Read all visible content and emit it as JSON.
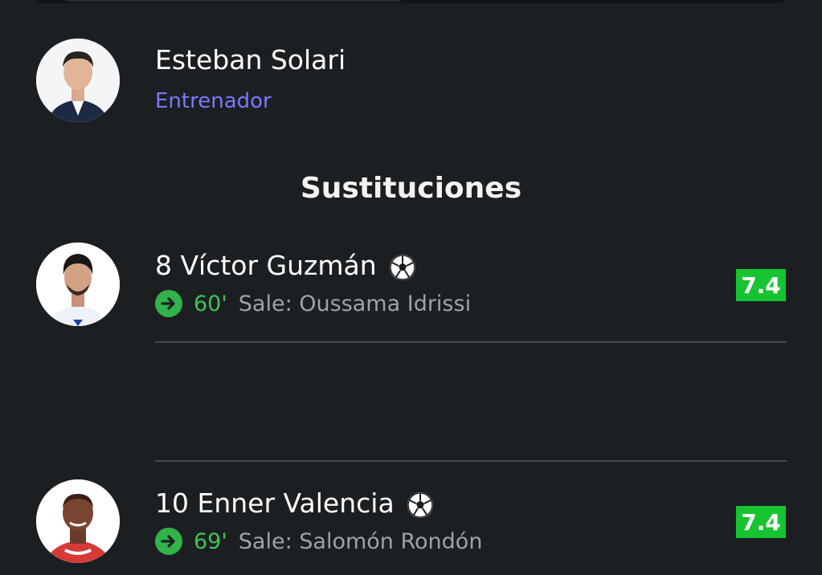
{
  "coach": {
    "name": "Esteban Solari",
    "role": "Entrenador"
  },
  "section_title": "Sustituciones",
  "substitutions": [
    {
      "player": "8 Víctor Guzmán",
      "minute": "60'",
      "out_text": "Sale: Oussama Idrissi",
      "rating": "7.4",
      "icons": [
        "soccer-ball-icon",
        "arrow-right-icon"
      ]
    },
    {
      "player": "10 Enner Valencia",
      "minute": "69'",
      "out_text": "Sale: Salomón Rondón",
      "rating": "7.4",
      "icons": [
        "soccer-ball-icon",
        "arrow-right-icon"
      ]
    }
  ],
  "colors": {
    "background": "#1c1f22",
    "role": "#7b78ff",
    "minute": "#3ec456",
    "rating_bg": "#16c431"
  }
}
